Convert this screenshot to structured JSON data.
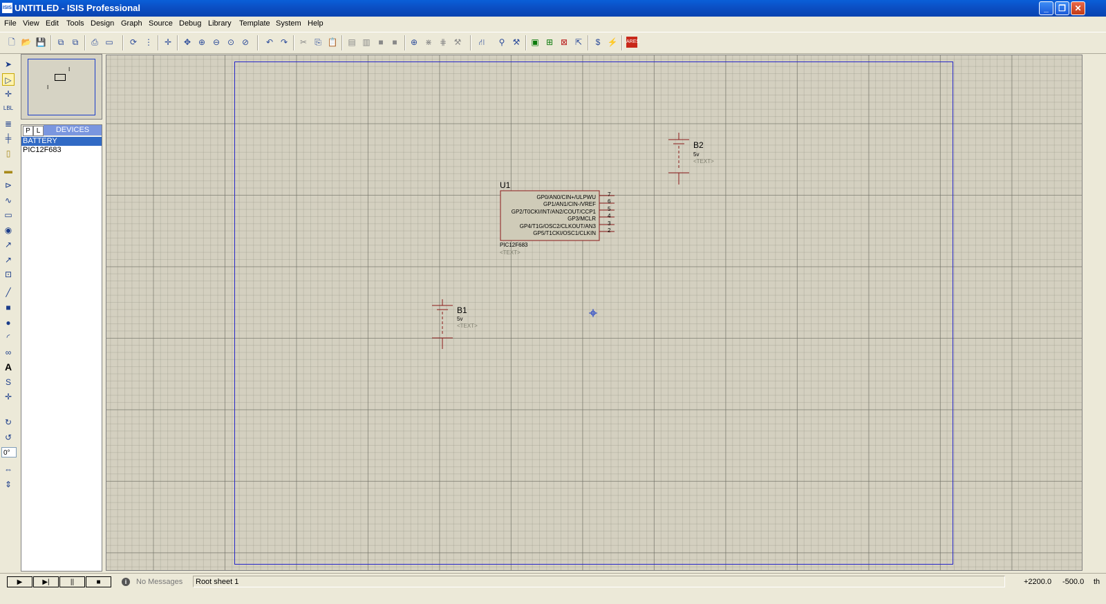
{
  "window": {
    "icon": "ISIS",
    "title": "UNTITLED - ISIS Professional",
    "controls": {
      "minimize": "_",
      "restore": "❐",
      "close": "✕"
    }
  },
  "menu": {
    "items": [
      "File",
      "View",
      "Edit",
      "Tools",
      "Design",
      "Graph",
      "Source",
      "Debug",
      "Library",
      "Template",
      "System",
      "Help"
    ]
  },
  "toolbar": {
    "icons": [
      "new-file-icon",
      "open-file-icon",
      "save-icon",
      "import-section-icon",
      "export-section-icon",
      "print-icon",
      "print-area-icon",
      "refresh-icon",
      "grid-toggle-icon",
      "origin-icon",
      "pan-icon",
      "zoom-in-icon",
      "zoom-out-icon",
      "zoom-all-icon",
      "zoom-area-icon",
      "undo-icon",
      "redo-icon",
      "cut-icon",
      "copy-icon",
      "paste-icon",
      "block-copy-icon",
      "block-move-icon",
      "block-rotate-icon",
      "block-delete-icon",
      "pick-device-icon",
      "make-device-icon",
      "packaging-tool-icon",
      "decompose-icon",
      "wire-autorouter-icon",
      "search-tag-icon",
      "property-assignment-icon",
      "design-explorer-icon",
      "new-sheet-icon",
      "remove-sheet-icon",
      "exit-to-parent-icon",
      "bill-of-materials-icon",
      "electrical-rule-check-icon",
      "netlist-to-ares-icon"
    ]
  },
  "tools": {
    "angle_value": "0°"
  },
  "overview": {
    "marks": [
      "I",
      "I"
    ]
  },
  "device_selector": {
    "p_button": "P",
    "l_button": "L",
    "title": "DEVICES",
    "items": [
      "BATTERY",
      "PIC12F683"
    ],
    "selected": "BATTERY"
  },
  "schematic": {
    "u1": {
      "ref": "U1",
      "part": "PIC12F683",
      "text": "<TEXT>",
      "pins": [
        {
          "name": "GP0/AN0/CIN+/ULPWU",
          "number": "7"
        },
        {
          "name": "GP1/AN1/CIN-/VREF",
          "number": "6"
        },
        {
          "name": "GP2/T0CKI/INT/AN2/COUT/CCP1",
          "number": "5"
        },
        {
          "name": "GP3/MCLR",
          "number": "4"
        },
        {
          "name": "GP4/T1G/OSC2/CLKOUT/AN3",
          "number": "3"
        },
        {
          "name": "GP5/T1CKI/OSC1/CLKIN",
          "number": "2"
        }
      ]
    },
    "b1": {
      "ref": "B1",
      "value": "5v",
      "text": "<TEXT>"
    },
    "b2": {
      "ref": "B2",
      "value": "5v",
      "text": "<TEXT>"
    },
    "colors": {
      "component": "#8b1a1a",
      "body_fill": "#cfcbb8",
      "sheet_border": "#2424c8",
      "cursor": "#1a3cc8"
    }
  },
  "statusbar": {
    "sim_buttons": [
      "▶",
      "▶|",
      "||",
      "■"
    ],
    "messages_icon": "i",
    "messages": "No Messages",
    "sheet": "Root sheet 1",
    "x": "+2200.0",
    "y": "-500.0",
    "units": "th"
  }
}
